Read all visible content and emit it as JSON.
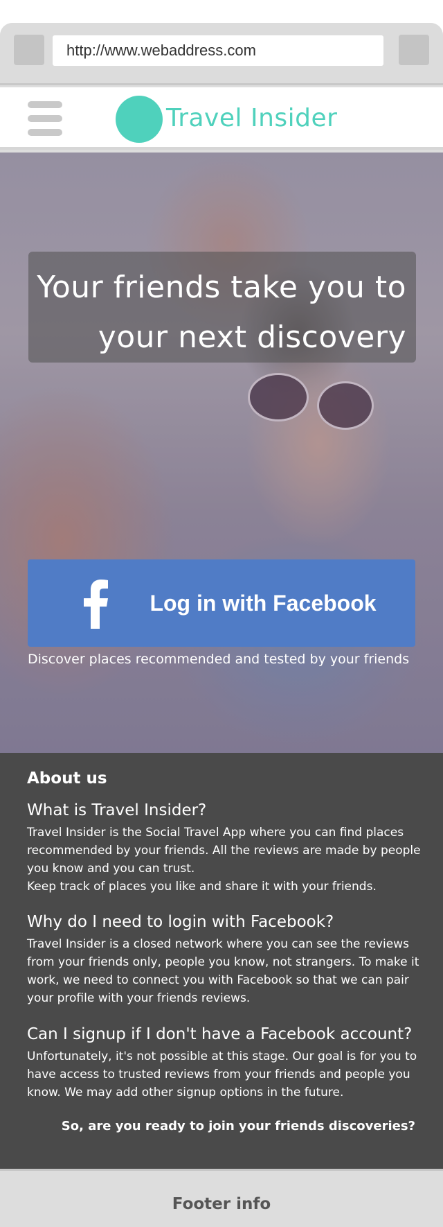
{
  "browser": {
    "url": "http://www.webaddress.com"
  },
  "header": {
    "app_title": "Travel Insider",
    "logo_color": "#4fd1bc",
    "menu_icon": "hamburger-icon"
  },
  "hero": {
    "headline_lines": [
      "Your friends take you to",
      "your next discovery"
    ],
    "facebook_button_label": "Log in with Facebook",
    "facebook_icon": "facebook-f-icon",
    "facebook_color": "#507cc6",
    "caption": "Discover places recommended and tested by your friends"
  },
  "about": {
    "heading": "About us",
    "faqs": [
      {
        "question": "What is Travel Insider?",
        "answer_lines": [
          "Travel Insider is the Social Travel App where you can find places recommended by your friends. All the reviews are made by people you know and you can trust.",
          "Keep track of places you like and share it with your friends."
        ]
      },
      {
        "question": "Why do I need to login with Facebook?",
        "answer_lines": [
          "Travel Insider is a closed network where you can see the reviews from your friends only, people you know, not strangers. To make it work, we need to connect you with Facebook so that we can pair your profile with your friends reviews."
        ]
      },
      {
        "question": "Can I signup if I don't have a Facebook account?",
        "answer_lines": [
          "Unfortunately, it's not possible at this stage. Our goal is for you to have access to trusted reviews from your friends and people you know. We may add other signup options in the future."
        ]
      }
    ],
    "cta": "So, are you ready to join your friends discoveries?"
  },
  "footer": {
    "text": "Footer info"
  }
}
